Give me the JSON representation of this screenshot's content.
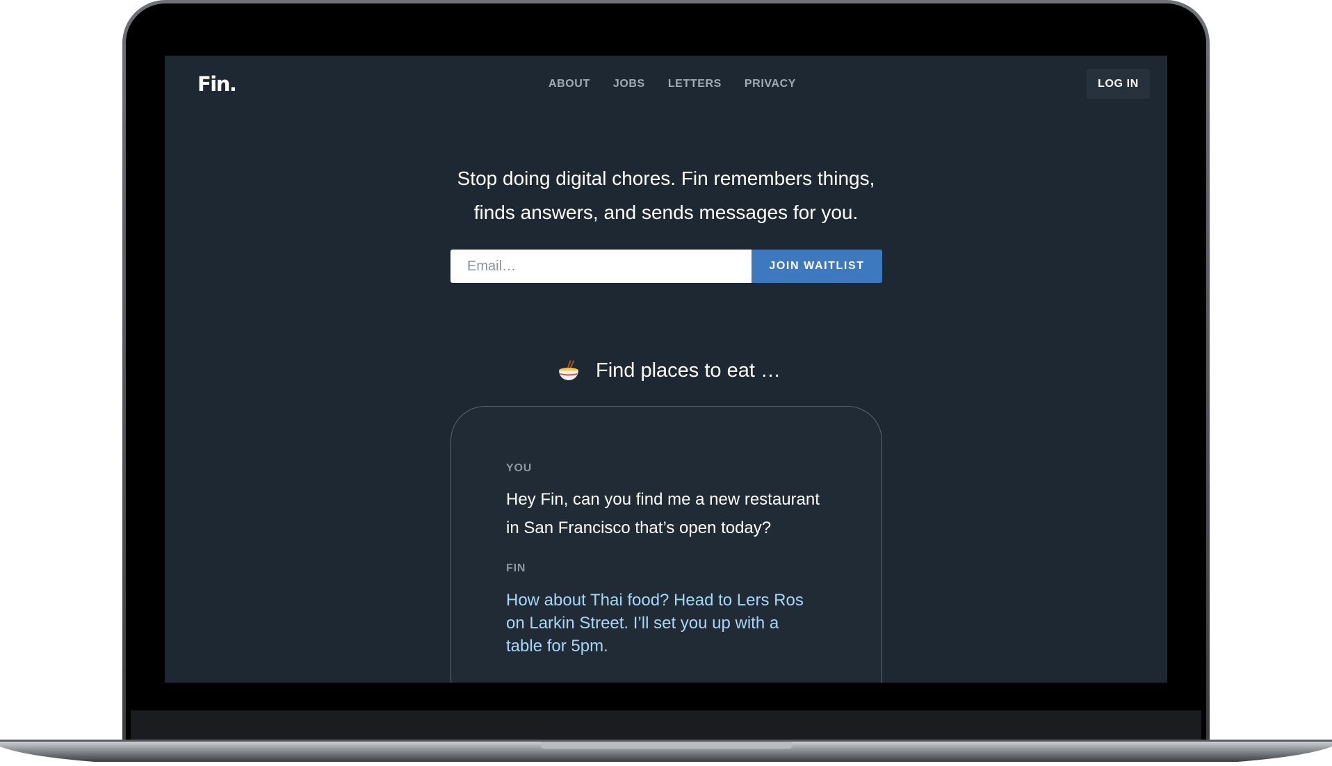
{
  "brand": {
    "logo_text": "Fin."
  },
  "nav": {
    "items": [
      "ABOUT",
      "JOBS",
      "LETTERS",
      "PRIVACY"
    ],
    "login_label": "LOG IN"
  },
  "hero": {
    "headline_line1": "Stop doing digital chores. Fin remembers things,",
    "headline_line2": "finds answers, and sends messages for you."
  },
  "signup": {
    "email_placeholder": "Email…",
    "email_value": "",
    "button_label": "JOIN WAITLIST"
  },
  "feature": {
    "icon": "noodle-bowl-icon",
    "title": "Find places to eat …"
  },
  "conversation": {
    "you_label": "YOU",
    "you_line1": "Hey Fin, can you find me a new restaurant",
    "you_line2": "in San Francisco that’s open today?",
    "fin_label": "FIN",
    "fin_line1": "How about Thai food? Head to Lers Ros",
    "fin_line2": "on Larkin Street. I’ll set you up with a",
    "fin_line3": "table for 5pm."
  },
  "colors": {
    "page_background": "#1e2833",
    "button_blue": "#3d79be",
    "fin_reply_text": "#a6d7f5",
    "nav_text": "#a3abb4"
  }
}
